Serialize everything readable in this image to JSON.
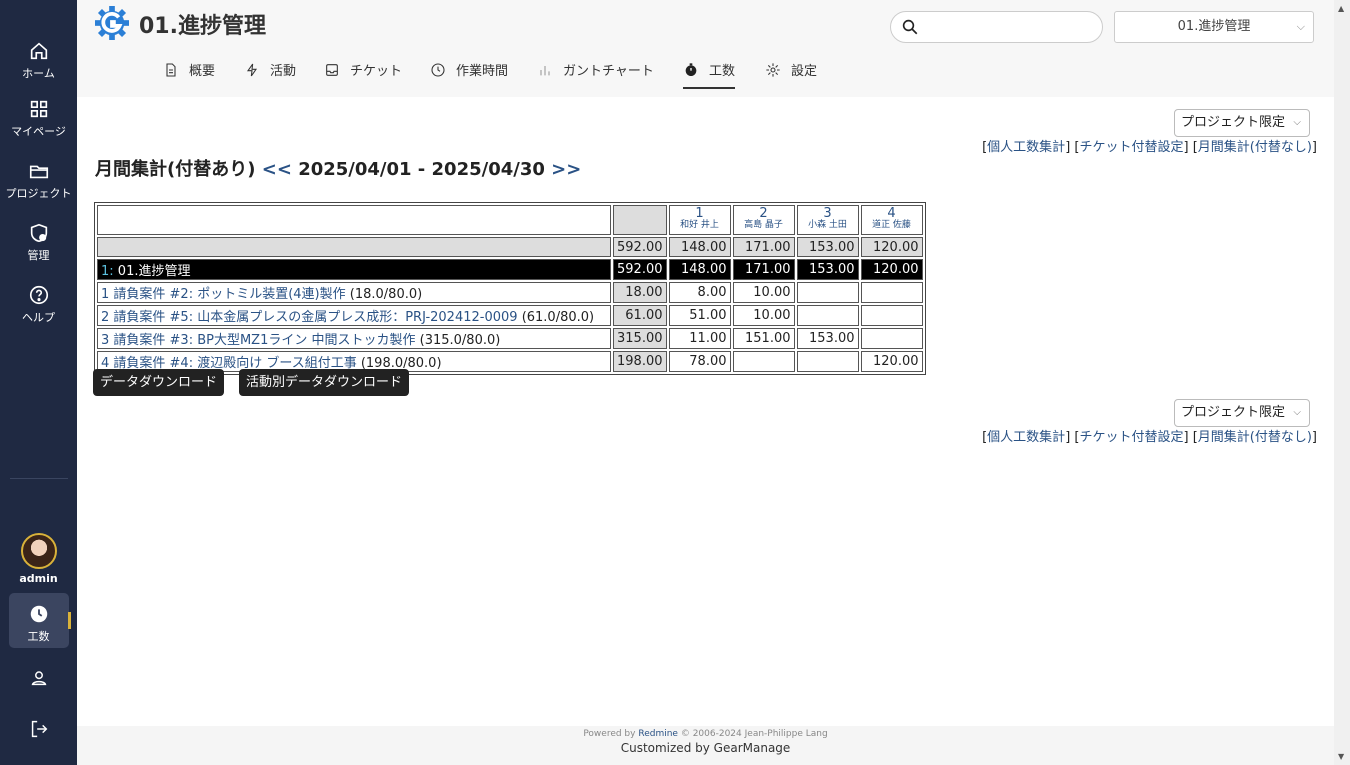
{
  "sidebar": {
    "items": [
      {
        "label": "ホーム",
        "icon": "home-icon"
      },
      {
        "label": "マイページ",
        "icon": "grid-icon"
      },
      {
        "label": "プロジェクト",
        "icon": "folder-icon"
      },
      {
        "label": "管理",
        "icon": "shield-icon"
      },
      {
        "label": "ヘルプ",
        "icon": "help-icon"
      }
    ],
    "user": "admin",
    "active_item": {
      "label": "工数",
      "icon": "clock-icon"
    },
    "bottom_icons": [
      "user-icon",
      "logout-icon"
    ]
  },
  "header": {
    "project_title": "01.進捗管理",
    "search_placeholder": "",
    "project_select": "01.進捗管理"
  },
  "tabs": [
    {
      "label": "概要",
      "icon": "document-icon"
    },
    {
      "label": "活動",
      "icon": "bolt-icon"
    },
    {
      "label": "チケット",
      "icon": "inbox-icon"
    },
    {
      "label": "作業時間",
      "icon": "clock-icon"
    },
    {
      "label": "ガントチャート",
      "icon": "bar-chart-icon"
    },
    {
      "label": "工数",
      "icon": "stopwatch-icon",
      "active": true
    },
    {
      "label": "設定",
      "icon": "gear-icon"
    }
  ],
  "filter": {
    "value": "プロジェクト限定"
  },
  "links": {
    "personal": "個人工数集計",
    "ticket": "チケット付替設定",
    "monthly": "月間集計(付替なし)"
  },
  "heading": {
    "title": "月間集計(付替あり)",
    "prev": "<<",
    "range": "2025/04/01 - 2025/04/30",
    "next": ">>"
  },
  "table": {
    "users": [
      {
        "num": "1",
        "name": "和好 井上"
      },
      {
        "num": "2",
        "name": "高島 晶子"
      },
      {
        "num": "3",
        "name": "小森 土田"
      },
      {
        "num": "4",
        "name": "道正 佐藤"
      }
    ],
    "sum": {
      "total": "592.00",
      "values": [
        "148.00",
        "171.00",
        "153.00",
        "120.00"
      ]
    },
    "project": {
      "prefix": "1:",
      "name": "01.進捗管理",
      "total": "592.00",
      "values": [
        "148.00",
        "171.00",
        "153.00",
        "120.00"
      ]
    },
    "issues": [
      {
        "link": "1 請負案件 #2: ポットミル装置(4連)製作",
        "est": "(18.0/80.0)",
        "total": "18.00",
        "values": [
          "8.00",
          "10.00",
          "",
          ""
        ]
      },
      {
        "link": "2 請負案件 #5: 山本金属プレスの金属プレス成形：PRJ-202412-0009",
        "est": "(61.0/80.0)",
        "total": "61.00",
        "values": [
          "51.00",
          "10.00",
          "",
          ""
        ]
      },
      {
        "link": "3 請負案件 #3: BP大型MZ1ライン 中間ストッカ製作",
        "est": "(315.0/80.0)",
        "total": "315.00",
        "values": [
          "11.00",
          "151.00",
          "153.00",
          ""
        ]
      },
      {
        "link": "4 請負案件 #4: 渡辺殿向け ブース組付工事",
        "est": "(198.0/80.0)",
        "total": "198.00",
        "values": [
          "78.00",
          "",
          "",
          "120.00"
        ]
      }
    ]
  },
  "buttons": {
    "download": "データダウンロード",
    "activity_download": "活動別データダウンロード"
  },
  "footer": {
    "powered": "Powered by",
    "redmine": "Redmine",
    "copyright": "© 2006-2024 Jean-Philippe Lang",
    "customized": "Customized by GearManage"
  }
}
